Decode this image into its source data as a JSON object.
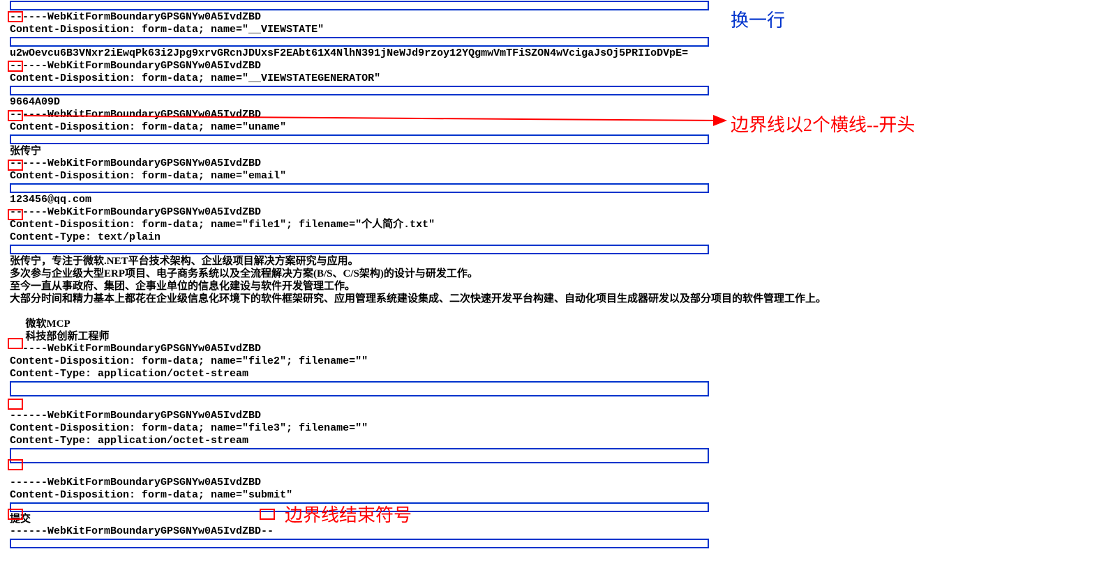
{
  "boundary": "----WebKitFormBoundaryGPSGNYw0A5IvdZBD",
  "dashes": "--",
  "parts": [
    {
      "boundary_line": "------WebKitFormBoundaryGPSGNYw0A5IvdZBD",
      "disposition": "Content-Disposition: form-data; name=\"__VIEWSTATE\"",
      "value": "u2wOevcu6B3VNxr2iEwqPk63i2Jpg9xrvGRcnJDUxsF2EAbt61X4NlhN391jNeWJd9rzoy12YQgmwVmTFiSZON4wVcigaJsOj5PRIIoDVpE="
    },
    {
      "boundary_line": "------WebKitFormBoundaryGPSGNYw0A5IvdZBD",
      "disposition": "Content-Disposition: form-data; name=\"__VIEWSTATEGENERATOR\"",
      "value": "9664A09D"
    },
    {
      "boundary_line": "------WebKitFormBoundaryGPSGNYw0A5IvdZBD",
      "disposition": "Content-Disposition: form-data; name=\"uname\"",
      "value": "张传宁"
    },
    {
      "boundary_line": "------WebKitFormBoundaryGPSGNYw0A5IvdZBD",
      "disposition": "Content-Disposition: form-data; name=\"email\"",
      "value": "123456@qq.com"
    },
    {
      "boundary_line": "------WebKitFormBoundaryGPSGNYw0A5IvdZBD",
      "disposition": "Content-Disposition: form-data; name=\"file1\"; filename=\"个人简介.txt\"",
      "content_type": "Content-Type: text/plain",
      "body": [
        "张传宁，专注于微软.NET平台技术架构、企业级项目解决方案研究与应用。",
        "多次参与企业级大型ERP项目、电子商务系统以及全流程解决方案(B/S、C/S架构)的设计与研发工作。",
        "至今一直从事政府、集团、企事业单位的信息化建设与软件开发管理工作。",
        "大部分时间和精力基本上都花在企业级信息化环境下的软件框架研究、应用管理系统建设集成、二次快速开发平台构建、自动化项目生成器研发以及部分项目的软件管理工作上。",
        "",
        "      微软MCP",
        "      科技部创新工程师"
      ]
    },
    {
      "boundary_line": "------WebKitFormBoundaryGPSGNYw0A5IvdZBD",
      "disposition": "Content-Disposition: form-data; name=\"file2\"; filename=\"\"",
      "content_type": "Content-Type: application/octet-stream",
      "body_empty": true
    },
    {
      "boundary_line": "------WebKitFormBoundaryGPSGNYw0A5IvdZBD",
      "disposition": "Content-Disposition: form-data; name=\"file3\"; filename=\"\"",
      "content_type": "Content-Type: application/octet-stream",
      "body_empty": true
    },
    {
      "boundary_line": "------WebKitFormBoundaryGPSGNYw0A5IvdZBD",
      "disposition": "Content-Disposition: form-data; name=\"submit\"",
      "value": "提交"
    }
  ],
  "closing_boundary": "------WebKitFormBoundaryGPSGNYw0A5IvdZBD--",
  "annotations": {
    "newline": "换一行",
    "boundary_prefix": "边界线以2个横线--开头",
    "boundary_end": "边界线结束符号"
  }
}
